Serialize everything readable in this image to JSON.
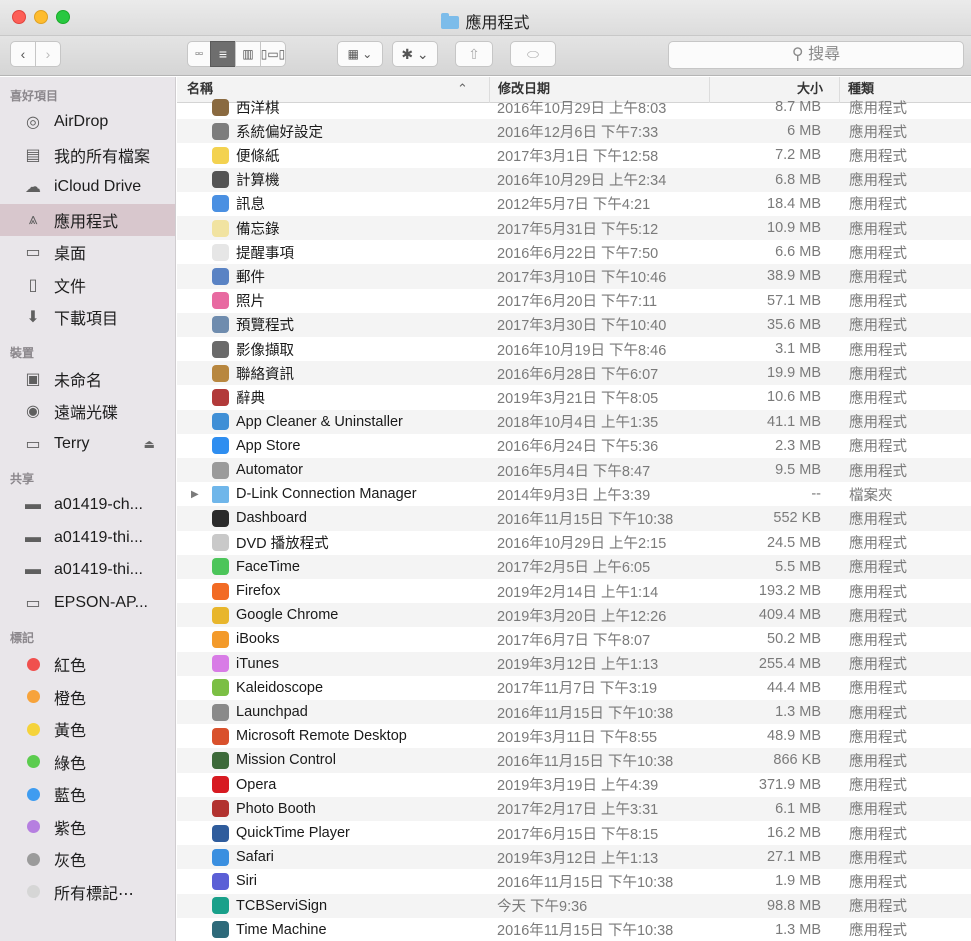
{
  "window": {
    "title": "應用程式"
  },
  "toolbar": {
    "search_placeholder": "搜尋",
    "buttons": [
      "back",
      "forward",
      "icon-view",
      "list-view",
      "column-view",
      "gallery-view",
      "group",
      "action",
      "share",
      "tags"
    ]
  },
  "sidebar": {
    "sections": [
      {
        "header": "喜好項目",
        "items": [
          {
            "label": "AirDrop",
            "icon": "airdrop-icon",
            "glyph": "◎"
          },
          {
            "label": "我的所有檔案",
            "icon": "all-files-icon",
            "glyph": "▤"
          },
          {
            "label": "iCloud Drive",
            "icon": "cloud-icon",
            "glyph": "☁"
          },
          {
            "label": "應用程式",
            "icon": "applications-icon",
            "glyph": "⩓",
            "selected": true
          },
          {
            "label": "桌面",
            "icon": "desktop-icon",
            "glyph": "▭"
          },
          {
            "label": "文件",
            "icon": "documents-icon",
            "glyph": "▯"
          },
          {
            "label": "下載項目",
            "icon": "downloads-icon",
            "glyph": "⬇"
          }
        ]
      },
      {
        "header": "裝置",
        "items": [
          {
            "label": "未命名",
            "icon": "disk-icon",
            "glyph": "▣"
          },
          {
            "label": "遠端光碟",
            "icon": "remote-disc-icon",
            "glyph": "◉"
          },
          {
            "label": "Terry",
            "icon": "hard-drive-icon",
            "glyph": "▭",
            "eject": true
          }
        ]
      },
      {
        "header": "共享",
        "items": [
          {
            "label": "a01419-ch...",
            "icon": "computer-icon",
            "glyph": "▬"
          },
          {
            "label": "a01419-thi...",
            "icon": "computer-icon",
            "glyph": "▬"
          },
          {
            "label": "a01419-thi...",
            "icon": "computer-icon",
            "glyph": "▬"
          },
          {
            "label": "EPSON-AP...",
            "icon": "monitor-icon",
            "glyph": "▭"
          }
        ]
      },
      {
        "header": "標記",
        "items": [
          {
            "label": "紅色",
            "tag_color": "#f0504e"
          },
          {
            "label": "橙色",
            "tag_color": "#f7a33b"
          },
          {
            "label": "黃色",
            "tag_color": "#f5d33b"
          },
          {
            "label": "綠色",
            "tag_color": "#5ccc4f"
          },
          {
            "label": "藍色",
            "tag_color": "#3f9cf0"
          },
          {
            "label": "紫色",
            "tag_color": "#b67fe0"
          },
          {
            "label": "灰色",
            "tag_color": "#9b9b9b"
          },
          {
            "label": "所有標記⋯",
            "tag_color": "#d6d6d6"
          }
        ]
      }
    ]
  },
  "list": {
    "columns": {
      "name": "名稱",
      "date": "修改日期",
      "size": "大小",
      "kind": "種類",
      "sort_indicator": "^"
    },
    "rows": [
      {
        "name": "西洋棋",
        "date": "2016年10月29日 上午8:03",
        "size": "8.7 MB",
        "kind": "應用程式",
        "color": "#8a6a40"
      },
      {
        "name": "系統偏好設定",
        "date": "2016年12月6日 下午7:33",
        "size": "6 MB",
        "kind": "應用程式",
        "color": "#7d7d7d"
      },
      {
        "name": "便條紙",
        "date": "2017年3月1日 下午12:58",
        "size": "7.2 MB",
        "kind": "應用程式",
        "color": "#f3d250"
      },
      {
        "name": "計算機",
        "date": "2016年10月29日 上午2:34",
        "size": "6.8 MB",
        "kind": "應用程式",
        "color": "#555555"
      },
      {
        "name": "訊息",
        "date": "2012年5月7日 下午4:21",
        "size": "18.4 MB",
        "kind": "應用程式",
        "color": "#4a90e2"
      },
      {
        "name": "備忘錄",
        "date": "2017年5月31日 下午5:12",
        "size": "10.9 MB",
        "kind": "應用程式",
        "color": "#f1e3a1"
      },
      {
        "name": "提醒事項",
        "date": "2016年6月22日 下午7:50",
        "size": "6.6 MB",
        "kind": "應用程式",
        "color": "#e6e6e6"
      },
      {
        "name": "郵件",
        "date": "2017年3月10日 下午10:46",
        "size": "38.9 MB",
        "kind": "應用程式",
        "color": "#5a83c4"
      },
      {
        "name": "照片",
        "date": "2017年6月20日 下午7:11",
        "size": "57.1 MB",
        "kind": "應用程式",
        "color": "#e86aa1"
      },
      {
        "name": "預覽程式",
        "date": "2017年3月30日 下午10:40",
        "size": "35.6 MB",
        "kind": "應用程式",
        "color": "#6f8cae"
      },
      {
        "name": "影像擷取",
        "date": "2016年10月19日 下午8:46",
        "size": "3.1 MB",
        "kind": "應用程式",
        "color": "#6a6a6a"
      },
      {
        "name": "聯絡資訊",
        "date": "2016年6月28日 下午6:07",
        "size": "19.9 MB",
        "kind": "應用程式",
        "color": "#b8873f"
      },
      {
        "name": "辭典",
        "date": "2019年3月21日 下午8:05",
        "size": "10.6 MB",
        "kind": "應用程式",
        "color": "#b23a3a"
      },
      {
        "name": "App Cleaner & Uninstaller",
        "date": "2018年10月4日 上午1:35",
        "size": "41.1 MB",
        "kind": "應用程式",
        "color": "#3f8fd6"
      },
      {
        "name": "App Store",
        "date": "2016年6月24日 下午5:36",
        "size": "2.3 MB",
        "kind": "應用程式",
        "color": "#2f8ef0"
      },
      {
        "name": "Automator",
        "date": "2016年5月4日 下午8:47",
        "size": "9.5 MB",
        "kind": "應用程式",
        "color": "#9a9a9a"
      },
      {
        "name": "D-Link Connection Manager",
        "date": "2014年9月3日 上午3:39",
        "size": "--",
        "kind": "檔案夾",
        "color": "#6fb6ea",
        "folder": true
      },
      {
        "name": "Dashboard",
        "date": "2016年11月15日 下午10:38",
        "size": "552 KB",
        "kind": "應用程式",
        "color": "#2b2b2b"
      },
      {
        "name": "DVD 播放程式",
        "date": "2016年10月29日 上午2:15",
        "size": "24.5 MB",
        "kind": "應用程式",
        "color": "#c9c9c9"
      },
      {
        "name": "FaceTime",
        "date": "2017年2月5日 上午6:05",
        "size": "5.5 MB",
        "kind": "應用程式",
        "color": "#4cc55a"
      },
      {
        "name": "Firefox",
        "date": "2019年2月14日 上午1:14",
        "size": "193.2 MB",
        "kind": "應用程式",
        "color": "#f26b24"
      },
      {
        "name": "Google Chrome",
        "date": "2019年3月20日 上午12:26",
        "size": "409.4 MB",
        "kind": "應用程式",
        "color": "#e8b62c"
      },
      {
        "name": "iBooks",
        "date": "2017年6月7日 下午8:07",
        "size": "50.2 MB",
        "kind": "應用程式",
        "color": "#f39a2a"
      },
      {
        "name": "iTunes",
        "date": "2019年3月12日 上午1:13",
        "size": "255.4 MB",
        "kind": "應用程式",
        "color": "#d87ce6"
      },
      {
        "name": "Kaleidoscope",
        "date": "2017年11月7日 下午3:19",
        "size": "44.4 MB",
        "kind": "應用程式",
        "color": "#7bbf44"
      },
      {
        "name": "Launchpad",
        "date": "2016年11月15日 下午10:38",
        "size": "1.3 MB",
        "kind": "應用程式",
        "color": "#8a8a8a"
      },
      {
        "name": "Microsoft Remote Desktop",
        "date": "2019年3月11日 下午8:55",
        "size": "48.9 MB",
        "kind": "應用程式",
        "color": "#d9512c"
      },
      {
        "name": "Mission Control",
        "date": "2016年11月15日 下午10:38",
        "size": "866 KB",
        "kind": "應用程式",
        "color": "#3d6a3a"
      },
      {
        "name": "Opera",
        "date": "2019年3月19日 上午4:39",
        "size": "371.9 MB",
        "kind": "應用程式",
        "color": "#d71a21"
      },
      {
        "name": "Photo Booth",
        "date": "2017年2月17日 上午3:31",
        "size": "6.1 MB",
        "kind": "應用程式",
        "color": "#b2322f"
      },
      {
        "name": "QuickTime Player",
        "date": "2017年6月15日 下午8:15",
        "size": "16.2 MB",
        "kind": "應用程式",
        "color": "#2f5c9c"
      },
      {
        "name": "Safari",
        "date": "2019年3月12日 上午1:13",
        "size": "27.1 MB",
        "kind": "應用程式",
        "color": "#3a8fe0"
      },
      {
        "name": "Siri",
        "date": "2016年11月15日 下午10:38",
        "size": "1.9 MB",
        "kind": "應用程式",
        "color": "#5b5fd6"
      },
      {
        "name": "TCBServiSign",
        "date": "今天 下午9:36",
        "size": "98.8 MB",
        "kind": "應用程式",
        "color": "#19a08a"
      },
      {
        "name": "Time Machine",
        "date": "2016年11月15日 下午10:38",
        "size": "1.3 MB",
        "kind": "應用程式",
        "color": "#2e6a7a"
      }
    ]
  }
}
